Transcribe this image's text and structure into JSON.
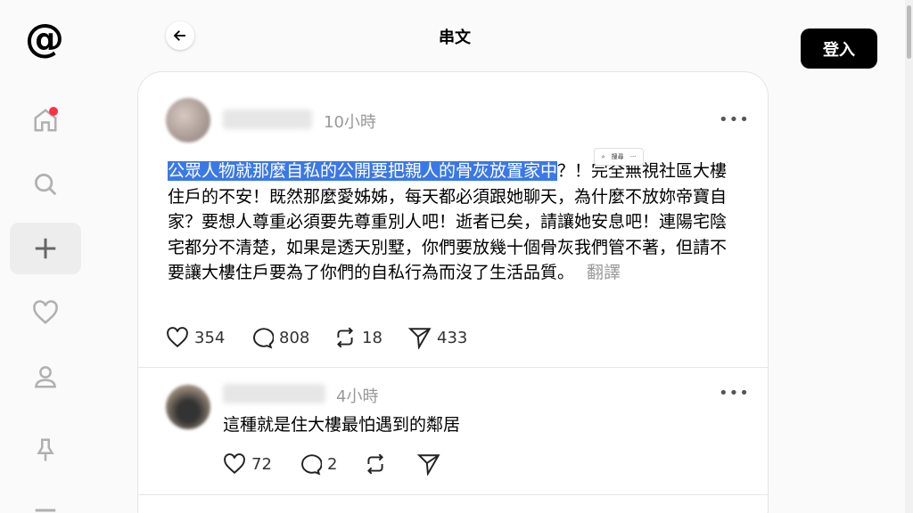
{
  "header": {
    "title": "串文",
    "login_label": "登入"
  },
  "sidebar": {
    "logo": "@",
    "items": [
      "home",
      "search",
      "create",
      "activity",
      "profile",
      "pinned"
    ]
  },
  "post": {
    "time": "10小時",
    "text_highlighted": "公眾人物就那麼自私的公開要把親人的骨灰放置家中",
    "text_rest": "？！完全無視社區大樓住戶的不安！既然那麼愛姊姊，每天都必須跟她聊天，為什麼不放妳帝寶自家？要想人尊重必須要先尊重別人吧！逝者已矣，請讓她安息吧！連陽宅陰宅都分不清楚，如果是透天別墅，你們要放幾十個骨灰我們管不著，但請不要讓大樓住戶要為了你們的自私行為而沒了生活品質。",
    "translate": "翻譯",
    "popup_label": "搜尋",
    "likes": "354",
    "comments": "808",
    "reposts": "18",
    "shares": "433"
  },
  "reply": {
    "time": "4小時",
    "text": "這種就是住大樓最怕遇到的鄰居",
    "likes": "72",
    "comments": "2"
  }
}
